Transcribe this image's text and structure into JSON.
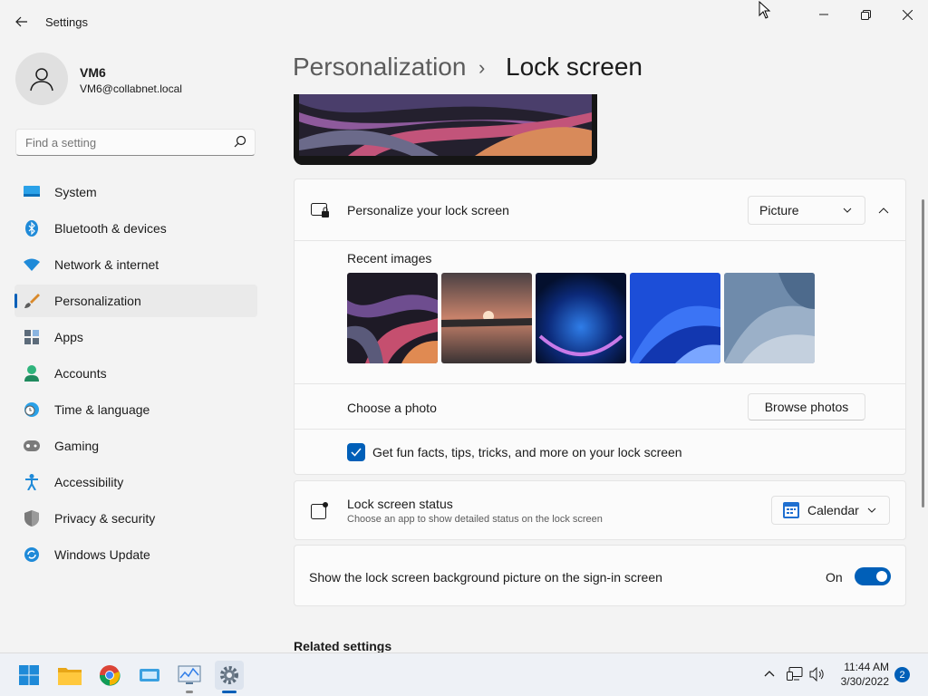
{
  "window": {
    "title": "Settings",
    "icons": {
      "back": "back-arrow-icon",
      "minimize": "minimize-icon",
      "maximize": "restore-icon",
      "close": "close-icon"
    }
  },
  "profile": {
    "name": "VM6",
    "email": "VM6@collabnet.local"
  },
  "search": {
    "placeholder": "Find a setting"
  },
  "nav": {
    "items": [
      {
        "label": "System",
        "icon": "system-icon"
      },
      {
        "label": "Bluetooth & devices",
        "icon": "bluetooth-icon"
      },
      {
        "label": "Network & internet",
        "icon": "wifi-icon"
      },
      {
        "label": "Personalization",
        "icon": "brush-icon",
        "active": true
      },
      {
        "label": "Apps",
        "icon": "apps-icon"
      },
      {
        "label": "Accounts",
        "icon": "accounts-icon"
      },
      {
        "label": "Time & language",
        "icon": "clock-globe-icon"
      },
      {
        "label": "Gaming",
        "icon": "gamepad-icon"
      },
      {
        "label": "Accessibility",
        "icon": "accessibility-icon"
      },
      {
        "label": "Privacy & security",
        "icon": "shield-icon"
      },
      {
        "label": "Windows Update",
        "icon": "windows-update-icon"
      }
    ]
  },
  "breadcrumb": {
    "parent": "Personalization",
    "separator": "›",
    "current": "Lock screen"
  },
  "personalize": {
    "label": "Personalize your lock screen",
    "value": "Picture",
    "recent_label": "Recent images",
    "images": [
      "swirl-wallpaper",
      "sunset-lake",
      "blue-glow",
      "blue-bloom",
      "silver-bloom"
    ],
    "choose_label": "Choose a photo",
    "browse_label": "Browse photos",
    "fun_facts_label": "Get fun facts, tips, tricks, and more on your lock screen",
    "fun_facts_checked": true
  },
  "status": {
    "label": "Lock screen status",
    "description": "Choose an app to show detailed status on the lock screen",
    "value": "Calendar"
  },
  "signin": {
    "label": "Show the lock screen background picture on the sign-in screen",
    "state": "On",
    "on": true
  },
  "related": {
    "title": "Related settings"
  },
  "taskbar": {
    "apps": [
      "windows-start-icon",
      "file-explorer-icon",
      "chrome-icon",
      "media-app-icon",
      "task-manager-icon",
      "settings-icon"
    ],
    "time": "11:44 AM",
    "date": "3/30/2022",
    "notifications": "2"
  },
  "colors": {
    "accent": "#005fb8",
    "background": "#f3f3f3",
    "card": "#fbfbfb"
  }
}
